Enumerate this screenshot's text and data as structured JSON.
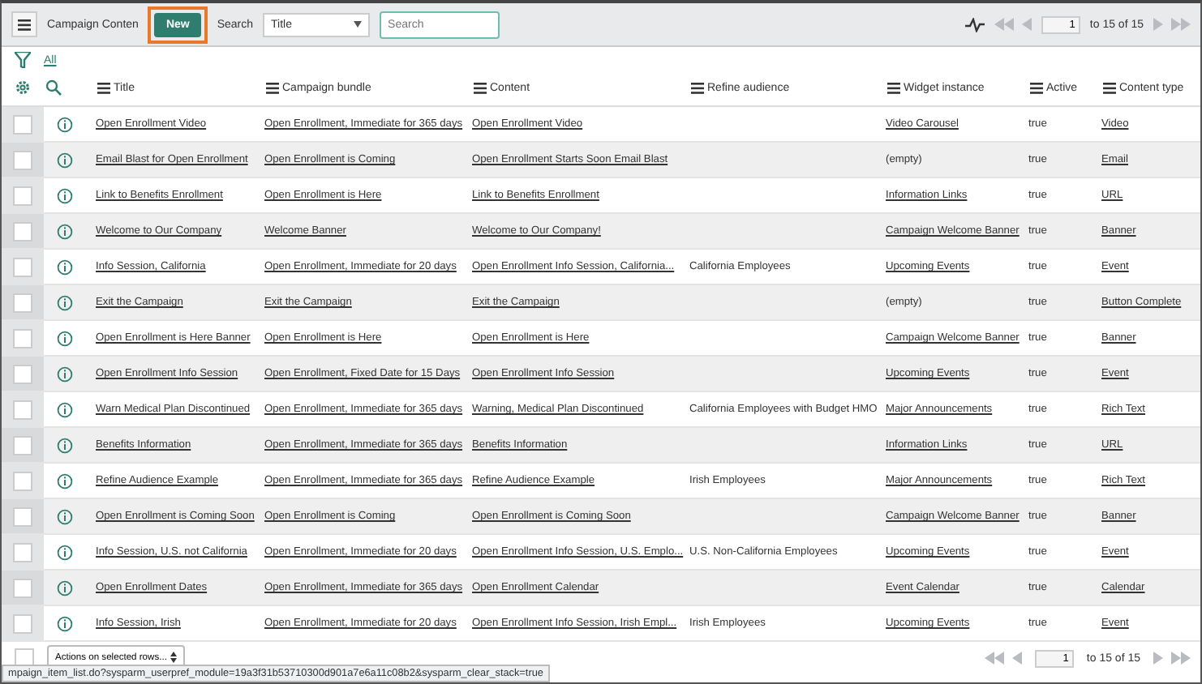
{
  "header": {
    "list_title": "Campaign Conten",
    "new_button": {
      "label": "New",
      "highlighted": true
    },
    "search_label": "Search",
    "search_field_select": "Title",
    "search_placeholder": "Search",
    "page": "1",
    "range": "to 15 of 15"
  },
  "filter": {
    "label": "All"
  },
  "columns": [
    "Title",
    "Campaign bundle",
    "Content",
    "Refine audience",
    "Widget instance",
    "Active",
    "Content type"
  ],
  "rows": [
    {
      "checked": false,
      "title": "Open Enrollment Video",
      "bundle": "Open Enrollment, Immediate for 365 days",
      "content": "Open Enrollment Video",
      "audience": "",
      "widget": "Video Carousel",
      "widget_link": true,
      "active": "true",
      "type": "Video"
    },
    {
      "checked": false,
      "title": "Email Blast for Open Enrollment",
      "bundle": "Open Enrollment is Coming",
      "content": "Open Enrollment Starts Soon Email Blast",
      "audience": "",
      "widget": "(empty)",
      "widget_link": false,
      "active": "true",
      "type": "Email"
    },
    {
      "checked": false,
      "title": "Link to Benefits Enrollment",
      "bundle": "Open Enrollment is Here",
      "content": "Link to Benefits Enrollment",
      "audience": "",
      "widget": "Information Links",
      "widget_link": true,
      "active": "true",
      "type": "URL"
    },
    {
      "checked": false,
      "title": "Welcome to Our Company",
      "bundle": "Welcome Banner",
      "content": "Welcome to Our Company!",
      "audience": "",
      "widget": "Campaign Welcome Banner",
      "widget_link": true,
      "active": "true",
      "type": "Banner"
    },
    {
      "checked": false,
      "title": "Info Session, California",
      "bundle": "Open Enrollment, Immediate for 20 days",
      "content": "Open Enrollment Info Session, California...",
      "audience": "California Employees",
      "widget": "Upcoming Events",
      "widget_link": true,
      "active": "true",
      "type": "Event"
    },
    {
      "checked": false,
      "title": "Exit the Campaign",
      "bundle": "Exit the Campaign",
      "content": "Exit the Campaign",
      "audience": "",
      "widget": "(empty)",
      "widget_link": false,
      "active": "true",
      "type": "Button Complete"
    },
    {
      "checked": false,
      "title": "Open Enrollment is Here Banner",
      "bundle": "Open Enrollment is Here",
      "content": "Open Enrollment is Here",
      "audience": "",
      "widget": "Campaign Welcome Banner",
      "widget_link": true,
      "active": "true",
      "type": "Banner"
    },
    {
      "checked": false,
      "title": "Open Enrollment Info Session",
      "bundle": "Open Enrollment, Fixed Date for 15 Days",
      "content": "Open Enrollment Info Session",
      "audience": "",
      "widget": "Upcoming Events",
      "widget_link": true,
      "active": "true",
      "type": "Event"
    },
    {
      "checked": false,
      "title": "Warn Medical Plan Discontinued",
      "bundle": "Open Enrollment, Immediate for 365 days",
      "content": "Warning, Medical Plan Discontinued",
      "audience": "California Employees with Budget HMO",
      "widget": "Major Announcements",
      "widget_link": true,
      "active": "true",
      "type": "Rich Text"
    },
    {
      "checked": false,
      "title": "Benefits Information",
      "bundle": "Open Enrollment, Immediate for 365 days",
      "content": "Benefits Information",
      "audience": "",
      "widget": "Information Links",
      "widget_link": true,
      "active": "true",
      "type": "URL"
    },
    {
      "checked": false,
      "title": "Refine Audience Example",
      "bundle": "Open Enrollment, Immediate for 365 days",
      "content": "Refine Audience Example",
      "audience": "Irish Employees",
      "widget": "Major Announcements",
      "widget_link": true,
      "active": "true",
      "type": "Rich Text"
    },
    {
      "checked": false,
      "title": "Open Enrollment is Coming Soon",
      "bundle": "Open Enrollment is Coming",
      "content": "Open Enrollment is Coming Soon",
      "audience": "",
      "widget": "Campaign Welcome Banner",
      "widget_link": true,
      "active": "true",
      "type": "Banner"
    },
    {
      "checked": false,
      "title": "Info Session, U.S. not California",
      "bundle": "Open Enrollment, Immediate for 20 days",
      "content": "Open Enrollment Info Session, U.S. Emplo...",
      "audience": "U.S. Non-California Employees",
      "widget": "Upcoming Events",
      "widget_link": true,
      "active": "true",
      "type": "Event"
    },
    {
      "checked": false,
      "title": "Open Enrollment Dates",
      "bundle": "Open Enrollment, Immediate for 365 days",
      "content": "Open Enrollment Calendar",
      "audience": "",
      "widget": "Event Calendar",
      "widget_link": true,
      "active": "true",
      "type": "Calendar"
    },
    {
      "checked": false,
      "title": "Info Session, Irish",
      "bundle": "Open Enrollment, Immediate for 20 days",
      "content": "Open Enrollment Info Session, Irish Empl...",
      "audience": "Irish Employees",
      "widget": "Upcoming Events",
      "widget_link": true,
      "active": "true",
      "type": "Event"
    }
  ],
  "footer": {
    "select_all_checked": false,
    "actions": "Actions on selected rows...",
    "page": "1",
    "range": "to 15 of 15"
  },
  "status_url": "mpaign_item_list.do?sysparm_userpref_module=19a3f31b53710300d901a7e6a11c08b2&sysparm_clear_stack=true"
}
